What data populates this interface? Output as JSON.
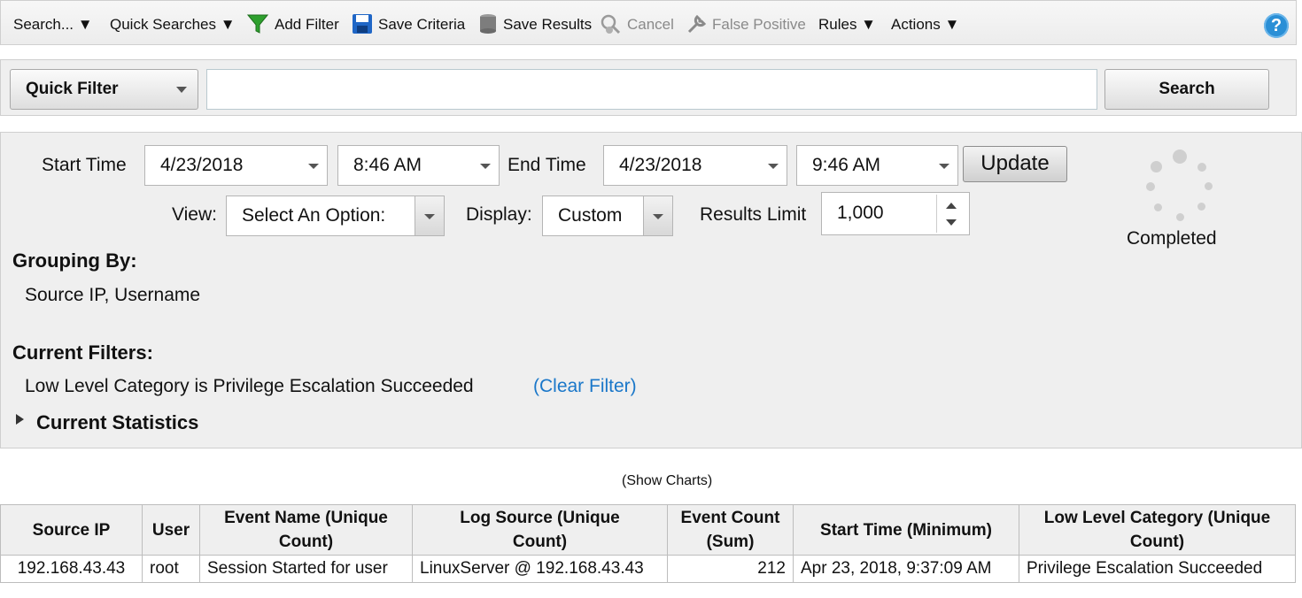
{
  "toolbar": {
    "search": "Search... ▼",
    "quick_searches": "Quick Searches ▼",
    "add_filter": "Add Filter",
    "save_criteria": "Save Criteria",
    "save_results": "Save Results",
    "cancel": "Cancel",
    "false_positive": "False Positive",
    "rules": "Rules ▼",
    "actions": "Actions ▼",
    "help": "?"
  },
  "quick_filter": {
    "select_label": "Quick Filter",
    "input_value": "",
    "search_button": "Search"
  },
  "criteria": {
    "start_time_label": "Start Time",
    "start_date": "4/23/2018",
    "start_time": "8:46 AM",
    "end_time_label": "End Time",
    "end_date": "4/23/2018",
    "end_time": "9:46 AM",
    "update_button": "Update",
    "view_label": "View:",
    "view_value": "Select An Option:",
    "display_label": "Display:",
    "display_value": "Custom",
    "results_limit_label": "Results Limit",
    "results_limit_value": "1,000",
    "status": "Completed"
  },
  "grouping": {
    "heading": "Grouping By:",
    "value": "Source IP, Username"
  },
  "filters": {
    "heading": "Current Filters:",
    "value": "Low Level Category is Privilege Escalation Succeeded",
    "clear_link": "(Clear Filter)"
  },
  "statistics": {
    "heading": "Current Statistics"
  },
  "show_charts": "(Show Charts)",
  "table": {
    "headers": {
      "source_ip": "Source IP",
      "user": "User",
      "event_name_1": "Event Name (Unique",
      "event_name_2": "Count)",
      "log_source_1": "Log Source (Unique",
      "log_source_2": "Count)",
      "event_count_1": "Event Count",
      "event_count_2": "(Sum)",
      "start_time": "Start Time (Minimum)",
      "llc_1": "Low Level Category (Unique",
      "llc_2": "Count)"
    },
    "rows": [
      {
        "source_ip": "192.168.43.43",
        "user": "root",
        "event_name": "Session Started for user",
        "log_source": "LinuxServer @ 192.168.43.43",
        "event_count": "212",
        "start_time": "Apr 23, 2018, 9:37:09 AM",
        "llc": "Privilege Escalation Succeeded"
      }
    ]
  }
}
